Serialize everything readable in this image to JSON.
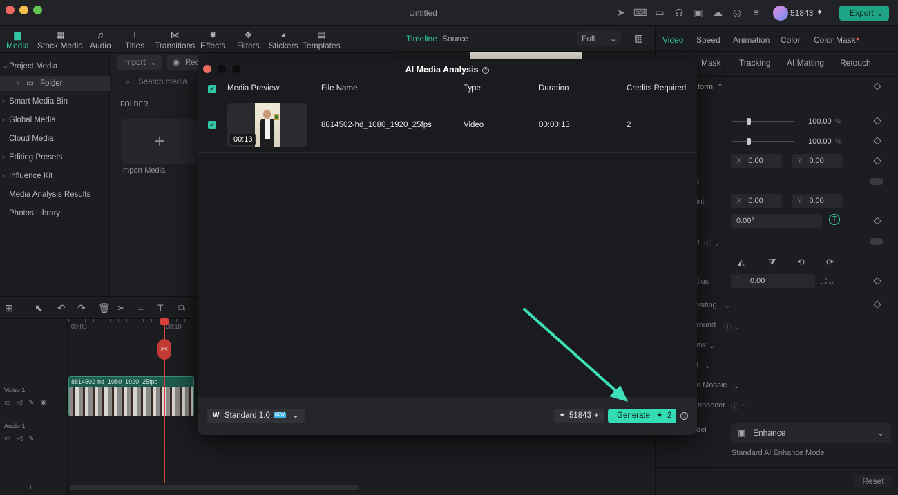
{
  "window": {
    "title": "Untitled",
    "credits": "51843",
    "export_label": "Export"
  },
  "toolbar": {
    "items": [
      "Media",
      "Stock Media",
      "Audio",
      "Titles",
      "Transitions",
      "Effects",
      "Filters",
      "Stickers",
      "Templates"
    ]
  },
  "left_panel": {
    "items": [
      "Project Media",
      "Folder",
      "Smart Media Bin",
      "Global Media",
      "Cloud Media",
      "Editing Presets",
      "Influence Kit",
      "Media Analysis Results",
      "Photos Library"
    ]
  },
  "media_area": {
    "import_label": "Import",
    "record_label": "Rec",
    "search_placeholder": "Search media",
    "folder_label": "FOLDER",
    "import_media_label": "Import Media"
  },
  "center": {
    "tab_timeline": "Timeline",
    "tab_source": "Source",
    "zoom": "Full"
  },
  "right_panel": {
    "tabs": [
      "Video",
      "Speed",
      "Animation",
      "Color",
      "Color Mask"
    ],
    "subtabs": [
      "Mask",
      "Tracking",
      "AI Matting",
      "Retouch"
    ],
    "transform_label": "form",
    "scale_x": "100.00",
    "scale_y": "100.00",
    "percent": "%",
    "pos_x": "0.00",
    "pos_y": "0.00",
    "anchor_x": "0.00",
    "anchor_y": "0.00",
    "rotate": "0.00°",
    "radius": "0.00",
    "partial_labels": [
      "e",
      "int",
      "r",
      "dius",
      "ositing",
      "round",
      "ew",
      "t",
      "e Mosaic",
      "nhancer",
      "del"
    ],
    "enhance_value": "Enhance",
    "enhance_mode": "Standard AI Enhance Mode",
    "reset_label": "Reset"
  },
  "timeline": {
    "time_start": "00:00",
    "time_mark": "00:10",
    "video_track": "Video 1",
    "audio_track": "Audio 1",
    "clip_name": "8814502-hd_1080_1920_25fps"
  },
  "modal": {
    "title": "AI Media Analysis",
    "columns": [
      "Media Preview",
      "File Name",
      "Type",
      "Duration",
      "Credits Required"
    ],
    "row": {
      "duration_badge": "00:13",
      "file_name": "8814502-hd_1080_1920_25fps",
      "type": "Video",
      "duration": "00:00:13",
      "credits": "2"
    },
    "model_label": "Standard 1.0",
    "new_badge": "NEW",
    "credits": "51843",
    "generate_label": "Generate",
    "generate_cost": "2"
  },
  "colors": {
    "accent": "#32c6a4",
    "generate": "#34dcb4",
    "playhead": "#d9403a",
    "annotation_arrow": "#3ee0b8"
  }
}
